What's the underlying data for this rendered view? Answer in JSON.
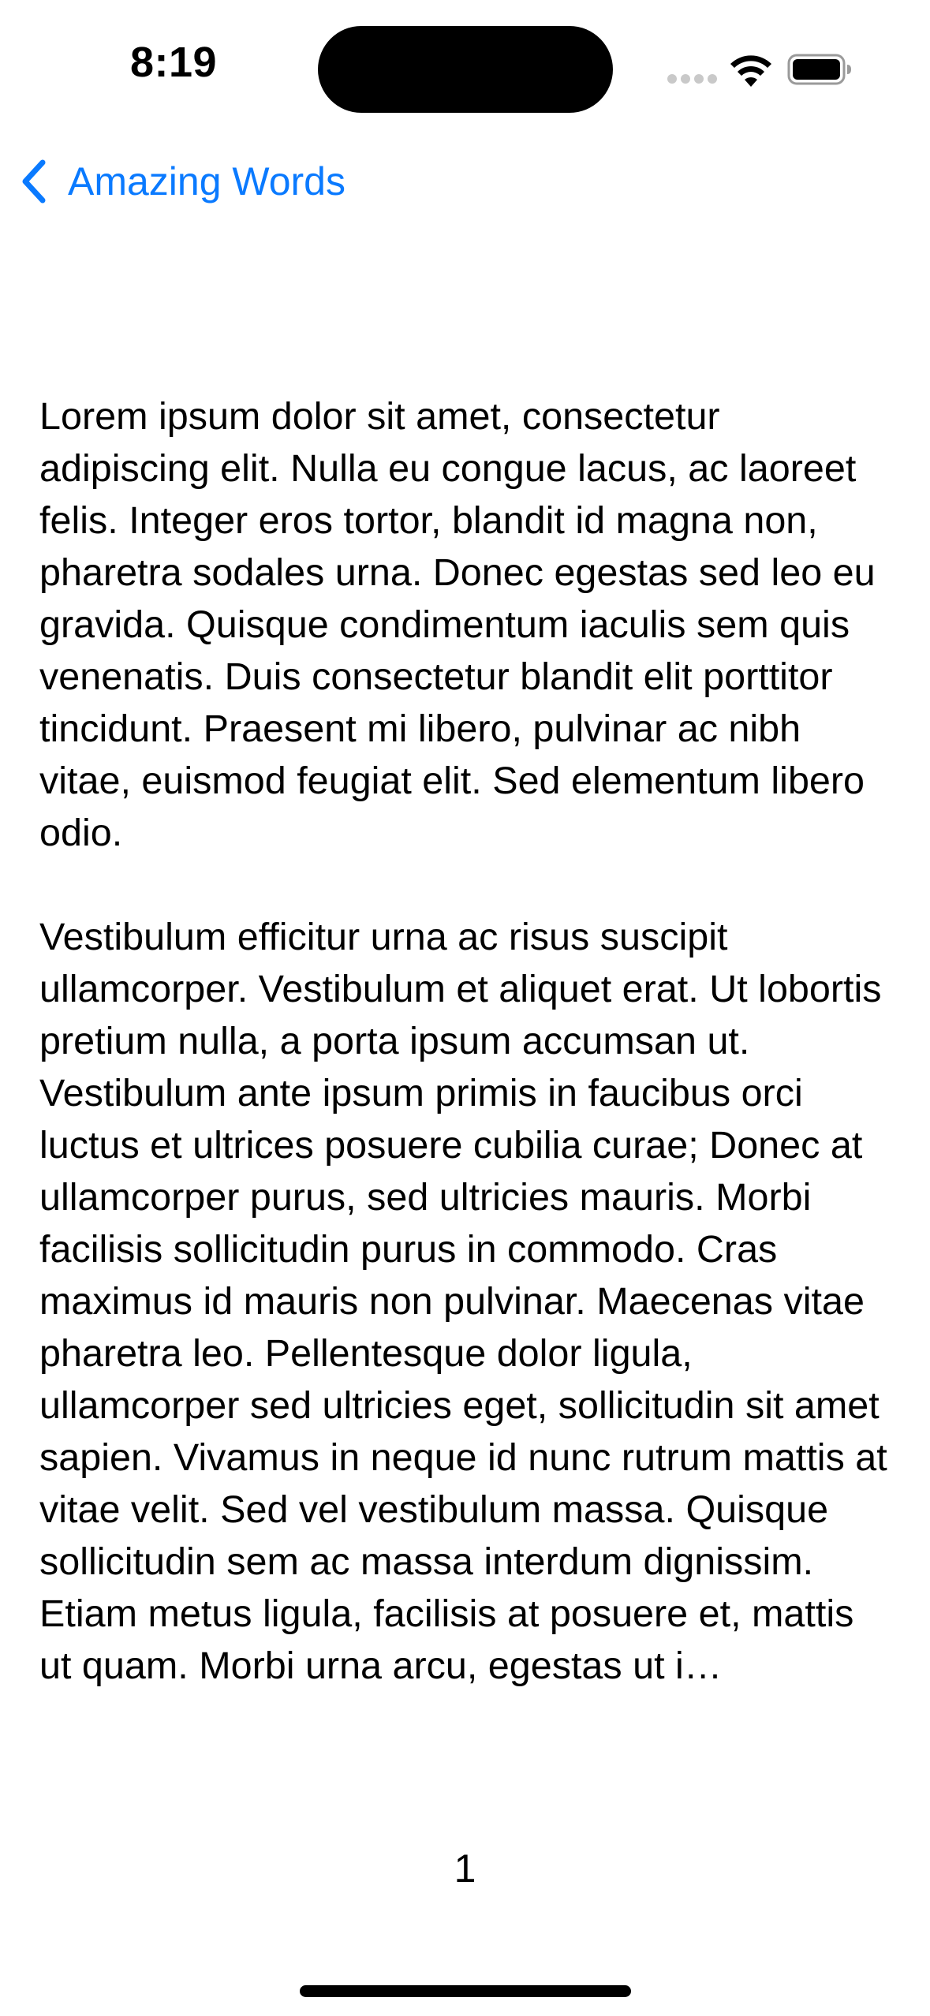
{
  "status_bar": {
    "time": "8:19",
    "icons": [
      "signal-icon",
      "wifi-icon",
      "battery-icon"
    ]
  },
  "nav": {
    "back_label": "Amazing Words",
    "back_icon": "chevron-left-icon",
    "accent_color": "#0a7aff"
  },
  "content": {
    "paragraph_1": "Lorem ipsum dolor sit amet, consectetur adipiscing elit. Nulla eu congue lacus, ac laoreet felis. Integer eros tortor, blandit id magna non, pharetra sodales urna. Donec egestas sed leo eu gravida. Quisque condimentum iaculis sem quis venenatis. Duis consectetur blandit elit porttitor tincidunt. Praesent mi libero, pulvinar ac nibh vitae, euismod feugiat elit. Sed elementum libero odio.",
    "paragraph_2": "Vestibulum efficitur urna ac risus suscipit ullamcorper. Vestibulum et aliquet erat. Ut lobortis pretium nulla, a porta ipsum accumsan ut. Vestibulum ante ipsum primis in faucibus orci luctus et ultrices posuere cubilia curae; Donec at ullamcorper purus, sed ultricies mauris. Morbi facilisis sollicitudin purus in commodo. Cras maximus id mauris non pulvinar. Maecenas vitae pharetra leo. Pellentesque dolor ligula, ullamcorper sed ultricies eget, sollicitudin sit amet sapien. Vivamus in neque id nunc rutrum mattis at vitae velit. Sed vel vestibulum massa. Quisque sollicitudin sem ac massa interdum dignissim. Etiam metus ligula, facilisis at posuere et, mattis ut quam. Morbi urna arcu, egestas ut i…"
  },
  "footer": {
    "page_number": "1"
  }
}
